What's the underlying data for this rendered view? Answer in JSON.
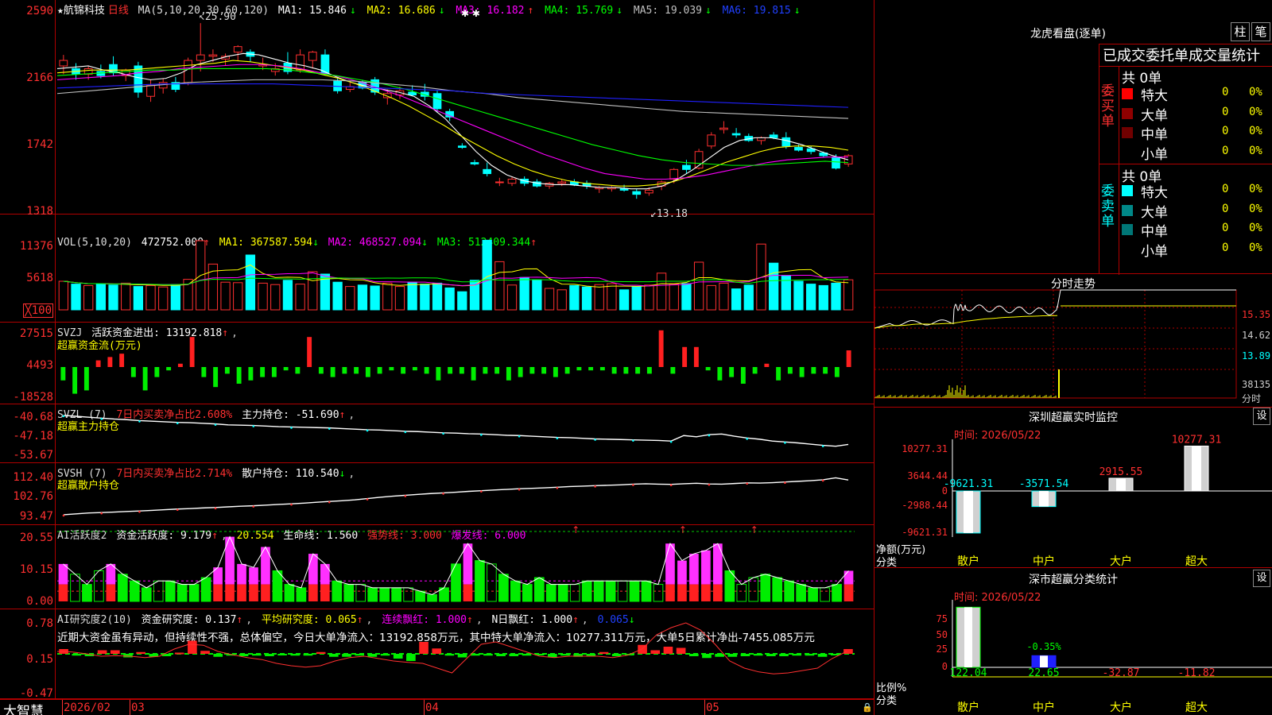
{
  "stock": {
    "name": "★航锦科技",
    "period": "日线"
  },
  "kline": {
    "params": "MA(5,10,20,30,60,120)",
    "ma": [
      {
        "label": "MA1: 15.846",
        "dir": "↓",
        "color": "#ffffff"
      },
      {
        "label": "MA2: 16.686",
        "dir": "↓",
        "color": "#ffff00"
      },
      {
        "label": "MA3: 16.182",
        "dir": "↑",
        "color": "#ff00ff"
      },
      {
        "label": "MA4: 15.769",
        "dir": "↓",
        "color": "#00ff00"
      },
      {
        "label": "MA5: 19.039",
        "dir": "↓",
        "color": "#c0c0c0"
      },
      {
        "label": "MA6: 19.815",
        "dir": "↓",
        "color": "#2020ff"
      }
    ],
    "high_label": "25.90",
    "low_label": "13.18",
    "y_ticks": [
      "2590",
      "2166",
      "1742",
      "1318"
    ],
    "y_range": [
      12.5,
      27.0
    ],
    "candles": [
      [
        22.8,
        23.6,
        22.2,
        23.2
      ],
      [
        22.6,
        23.0,
        21.8,
        22.2
      ],
      [
        22.2,
        22.8,
        21.8,
        22.6
      ],
      [
        22.4,
        22.9,
        21.9,
        22.1
      ],
      [
        22.9,
        23.5,
        22.1,
        22.3
      ],
      [
        22.1,
        22.6,
        21.7,
        22.5
      ],
      [
        22.8,
        23.1,
        20.5,
        20.9
      ],
      [
        20.6,
        21.8,
        20.2,
        21.4
      ],
      [
        21.2,
        21.9,
        20.8,
        21.6
      ],
      [
        21.6,
        22.0,
        20.9,
        21.1
      ],
      [
        21.6,
        23.4,
        21.4,
        23.2
      ],
      [
        23.2,
        25.9,
        22.4,
        23.6
      ],
      [
        23.5,
        24.0,
        23.1,
        23.6
      ],
      [
        23.3,
        23.7,
        22.8,
        23.5
      ],
      [
        23.8,
        24.3,
        23.2,
        24.2
      ],
      [
        23.8,
        24.0,
        23.1,
        23.5
      ],
      [
        22.8,
        23.4,
        22.5,
        22.9
      ],
      [
        22.4,
        23.0,
        22.1,
        22.6
      ],
      [
        23.0,
        23.8,
        22.2,
        22.4
      ],
      [
        22.5,
        24.0,
        22.3,
        23.6
      ],
      [
        23.2,
        23.9,
        22.6,
        23.8
      ],
      [
        23.6,
        24.0,
        22.1,
        22.2
      ],
      [
        21.7,
        21.9,
        20.8,
        21.0
      ],
      [
        21.1,
        21.6,
        20.9,
        21.3
      ],
      [
        21.6,
        21.8,
        21.1,
        21.2
      ],
      [
        21.8,
        22.0,
        20.7,
        20.9
      ],
      [
        20.5,
        21.1,
        20.0,
        20.8
      ],
      [
        20.7,
        21.3,
        20.4,
        21.0
      ],
      [
        20.9,
        21.4,
        20.6,
        20.7
      ],
      [
        20.9,
        21.5,
        20.3,
        20.6
      ],
      [
        20.8,
        21.0,
        19.4,
        19.7
      ],
      [
        19.5,
        19.7,
        18.8,
        19.1
      ],
      [
        17.0,
        17.2,
        16.8,
        16.9
      ],
      [
        15.8,
        16.0,
        15.6,
        15.7
      ],
      [
        15.3,
        15.8,
        14.8,
        15.0
      ],
      [
        14.4,
        14.7,
        14.1,
        14.4
      ],
      [
        14.3,
        14.8,
        14.1,
        14.6
      ],
      [
        14.6,
        14.8,
        14.1,
        14.3
      ],
      [
        14.4,
        14.6,
        14.0,
        14.1
      ],
      [
        14.1,
        14.4,
        13.9,
        14.3
      ],
      [
        14.3,
        14.6,
        14.1,
        14.4
      ],
      [
        14.4,
        14.6,
        14.1,
        14.2
      ],
      [
        14.3,
        14.5,
        13.9,
        14.1
      ],
      [
        13.9,
        14.1,
        13.6,
        14.0
      ],
      [
        13.9,
        14.1,
        13.7,
        14.0
      ],
      [
        13.9,
        14.2,
        13.7,
        13.8
      ],
      [
        13.7,
        13.9,
        13.18,
        13.5
      ],
      [
        13.6,
        14.0,
        13.4,
        13.8
      ],
      [
        14.1,
        14.5,
        13.8,
        14.4
      ],
      [
        14.6,
        15.4,
        14.3,
        15.3
      ],
      [
        15.6,
        16.0,
        15.0,
        15.3
      ],
      [
        15.4,
        16.8,
        15.3,
        16.6
      ],
      [
        17.0,
        18.0,
        16.8,
        17.8
      ],
      [
        18.2,
        18.8,
        17.9,
        18.3
      ],
      [
        17.9,
        18.3,
        17.6,
        17.8
      ],
      [
        17.7,
        17.9,
        17.3,
        17.4
      ],
      [
        17.4,
        17.7,
        17.1,
        17.6
      ],
      [
        17.8,
        18.0,
        17.5,
        17.6
      ],
      [
        17.6,
        18.0,
        16.8,
        17.0
      ],
      [
        16.9,
        17.1,
        16.6,
        16.7
      ],
      [
        16.8,
        17.0,
        16.4,
        16.6
      ],
      [
        16.5,
        16.6,
        16.2,
        16.3
      ],
      [
        16.2,
        16.4,
        15.3,
        15.4
      ],
      [
        15.7,
        16.4,
        15.5,
        16.3
      ]
    ],
    "ma_lines": [
      [
        22.6,
        22.7,
        22.8,
        22.5,
        22.3,
        22.0,
        21.8,
        21.9,
        22.3,
        22.9,
        23.2,
        23.5,
        23.7,
        23.6,
        23.3,
        23.0,
        22.8,
        22.5,
        22.0,
        21.6,
        21.3,
        21.1,
        20.9,
        20.6,
        19.9,
        19.0,
        17.8,
        16.6,
        15.6,
        14.9,
        14.5,
        14.3,
        14.2,
        14.2,
        14.1,
        14.0,
        14.0,
        13.9,
        13.9,
        14.1,
        14.6,
        15.3,
        16.1,
        16.9,
        17.4,
        17.6,
        17.6,
        17.4,
        17.1,
        16.7,
        16.3,
        16.0
      ],
      [
        22.3,
        22.4,
        22.5,
        22.5,
        22.5,
        22.6,
        22.7,
        22.8,
        22.9,
        23.0,
        23.2,
        23.1,
        22.9,
        22.7,
        22.5,
        22.2,
        21.9,
        21.5,
        21.0,
        20.5,
        19.9,
        19.2,
        18.5,
        17.7,
        17.0,
        16.3,
        15.7,
        15.2,
        14.8,
        14.5,
        14.3,
        14.2,
        14.1,
        14.1,
        14.2,
        14.4,
        14.8,
        15.3,
        15.8,
        16.2,
        16.6,
        16.9,
        17.0,
        17.0,
        16.9,
        16.7
      ],
      [
        21.8,
        21.9,
        22.0,
        22.1,
        22.3,
        22.4,
        22.6,
        22.7,
        22.8,
        22.9,
        22.9,
        22.8,
        22.6,
        22.3,
        22.0,
        21.6,
        21.1,
        20.6,
        20.0,
        19.4,
        18.8,
        18.2,
        17.6,
        17.0,
        16.4,
        15.9,
        15.4,
        15.0,
        14.8,
        14.6,
        14.6,
        14.7,
        14.9,
        15.2,
        15.5,
        15.8,
        16.0,
        16.1,
        16.2,
        16.2
      ],
      [
        22.1,
        22.2,
        22.3,
        22.4,
        22.5,
        22.5,
        22.6,
        22.6,
        22.6,
        22.6,
        22.5,
        22.3,
        22.1,
        21.8,
        21.5,
        21.1,
        20.6,
        20.1,
        19.6,
        19.1,
        18.6,
        18.1,
        17.6,
        17.1,
        16.7,
        16.3,
        16.0,
        15.8,
        15.7,
        15.6,
        15.6,
        15.7,
        15.8,
        15.9,
        15.8
      ],
      [
        20.8,
        21.0,
        21.2,
        21.4,
        21.6,
        21.7,
        21.8,
        21.8,
        21.8,
        21.7,
        21.5,
        21.3,
        21.0,
        20.8,
        20.5,
        20.3,
        20.1,
        19.9,
        19.7,
        19.5,
        19.4,
        19.3,
        19.2,
        19.1,
        19.0
      ],
      [
        21.2,
        21.3,
        21.4,
        21.5,
        21.5,
        21.5,
        21.5,
        21.4,
        21.3,
        21.2,
        21.1,
        21.0,
        20.8,
        20.7,
        20.6,
        20.5,
        20.4,
        20.3,
        20.2,
        20.1,
        20.0,
        19.9,
        19.8
      ]
    ]
  },
  "vol": {
    "params": "VOL(5,10,20)",
    "value": "472752.000",
    "dir": "↑",
    "ma1": "MA1: 367587.594",
    "ma1_dir": "↓",
    "ma2": "MA2: 468527.094",
    "ma2_dir": "↓",
    "ma3": "MA3: 512409.344",
    "ma3_dir": "↑",
    "y_ticks": [
      "11376",
      "5618",
      "╳100"
    ],
    "values": [
      6.0,
      5.4,
      5.1,
      5.5,
      5.2,
      5.6,
      4.9,
      5.1,
      4.8,
      5.3,
      6.4,
      14.5,
      9.6,
      5.8,
      5.7,
      11.5,
      5.6,
      5.3,
      6.2,
      5.4,
      8.0,
      7.5,
      5.8,
      4.9,
      5.2,
      5.0,
      5.6,
      4.9,
      5.8,
      5.4,
      5.6,
      4.6,
      3.8,
      6.2,
      14.6,
      10.1,
      5.2,
      6.8,
      6.3,
      4.5,
      4.2,
      5.1,
      4.8,
      5.3,
      5.5,
      4.2,
      4.9,
      5.2,
      7.7,
      5.4,
      5.5,
      10.0,
      5.1,
      5.6,
      4.4,
      5.2,
      13.8,
      9.8,
      7.2,
      6.0,
      5.4,
      5.1,
      5.6,
      6.3
    ]
  },
  "svzj": {
    "label": "SVZJ",
    "title": "活跃资金进出: 13192.818",
    "dir": "↑",
    "sub": "超赢资金流(万元)",
    "y_ticks": [
      "27515",
      "4493",
      "-18528"
    ],
    "values": [
      -4,
      -8,
      -7,
      2,
      3,
      4,
      -3,
      -7,
      -3,
      -1,
      1,
      9,
      -3,
      -6,
      -2,
      -5,
      -4,
      -3,
      -3,
      -1,
      -2,
      9,
      -2,
      -3,
      -2,
      -2,
      -3,
      -2,
      -1,
      -2,
      -1,
      -2,
      -4,
      -2,
      -2,
      -4,
      -2,
      -2,
      -4,
      -3,
      -2,
      -2,
      -3,
      -2,
      -1,
      -1,
      -1,
      -2,
      -2,
      -2,
      -2,
      11,
      -2,
      6,
      6,
      -1,
      -4,
      -3,
      -5,
      -2,
      1,
      -4,
      -2,
      -3,
      -2,
      -2,
      -3,
      5
    ]
  },
  "svzl": {
    "label": "SVZL (7)",
    "title_a": "7日内买卖净占比2.608%",
    "title_b": "主力持仓: -51.690",
    "dir": "↑",
    "sub": "超赢主力持仓",
    "y_ticks": [
      "-40.68",
      "-47.18",
      "-53.67"
    ],
    "values": [
      -42.2,
      -42.5,
      -42.8,
      -43.1,
      -43.4,
      -43.6,
      -43.9,
      -44.1,
      -44.3,
      -44.5,
      -44.6,
      -44.8,
      -45.0,
      -45.3,
      -45.4,
      -45.5,
      -45.7,
      -45.9,
      -46.0,
      -46.1,
      -46.2,
      -46.3,
      -46.5,
      -46.7,
      -46.9,
      -47.0,
      -47.2,
      -47.4,
      -47.5,
      -47.7,
      -47.9,
      -48.0,
      -48.2,
      -48.3,
      -48.5,
      -48.7,
      -48.8,
      -49.0,
      -49.2,
      -49.4,
      -49.5,
      -49.7,
      -49.9,
      -50.0,
      -50.1,
      -50.2,
      -50.3,
      -50.4,
      -50.6,
      -48.8,
      -49.2,
      -48.5,
      -48.3,
      -49.0,
      -49.6,
      -50.0,
      -50.6,
      -50.9,
      -51.2,
      -51.6,
      -52.0,
      -52.3,
      -51.7
    ]
  },
  "svsh": {
    "label": "SVSH (7)",
    "title_a": "7日内买卖净占比2.714%",
    "title_b": "散户持仓: 110.540",
    "dir": "↓",
    "sub": "超赢散户持仓",
    "y_ticks": [
      "112.40",
      "102.76",
      "93.47"
    ],
    "values": [
      94.6,
      95.0,
      95.4,
      95.6,
      95.8,
      96.1,
      96.3,
      96.6,
      96.9,
      97.2,
      97.4,
      97.7,
      97.9,
      98.2,
      98.5,
      98.7,
      99.0,
      99.3,
      99.6,
      99.9,
      100.3,
      100.7,
      101.0,
      101.4,
      102.0,
      102.6,
      103.1,
      103.5,
      103.9,
      104.3,
      104.6,
      104.9,
      105.3,
      105.6,
      105.9,
      106.2,
      106.5,
      106.7,
      106.9,
      107.2,
      107.5,
      107.7,
      107.9,
      108.1,
      108.3,
      108.6,
      108.8,
      108.6,
      108.5,
      108.8,
      109.0,
      108.7,
      108.6,
      108.9,
      109.2,
      109.1,
      109.3,
      109.6,
      109.9,
      110.2,
      110.6,
      111.5,
      110.5
    ]
  },
  "ai_active": {
    "label": "AI活跃度2",
    "t1": "资金活跃度: 9.179",
    "t1_dir": "↑",
    "t2": "20.554",
    "t3": "生命线: 1.560",
    "t4": "强势线: 3.000",
    "t5": "爆发线: 6.000",
    "y_ticks": [
      "20.55",
      "10.15",
      "0.00"
    ],
    "values": [
      11,
      8,
      5,
      9,
      11,
      8,
      6,
      4,
      6,
      6,
      5,
      5,
      7,
      10,
      19,
      11,
      10,
      16,
      9,
      5,
      4,
      14,
      11,
      6,
      5,
      5,
      4,
      4,
      4,
      4,
      3,
      2,
      4,
      11,
      17,
      12,
      11,
      8,
      6,
      5,
      7,
      5,
      5,
      5,
      6,
      6,
      6,
      6,
      6,
      6,
      5,
      17,
      12,
      14,
      15,
      17,
      9,
      5,
      7,
      8,
      7,
      6,
      5,
      4,
      4,
      5,
      9
    ],
    "pink": [
      1,
      0,
      0,
      0,
      1,
      0,
      0,
      0,
      0,
      0,
      0,
      0,
      0,
      1,
      1,
      1,
      1,
      1,
      0,
      0,
      0,
      1,
      1,
      0,
      0,
      0,
      0,
      0,
      0,
      0,
      0,
      0,
      0,
      0,
      1,
      0,
      0,
      0,
      0,
      0,
      0,
      0,
      0,
      0,
      0,
      0,
      0,
      0,
      0,
      0,
      0,
      1,
      1,
      1,
      1,
      1,
      0,
      0,
      0,
      0,
      0,
      0,
      0,
      0,
      0,
      0,
      1
    ],
    "arrows_at": [
      43,
      52,
      58
    ]
  },
  "ai_research": {
    "label": "AI研究度2(10)",
    "t1": "资金研究度: 0.137",
    "t1_dir": "↑",
    "t2": "平均研究度: 0.065",
    "t2_dir": "↑",
    "t3": "连续飘红: 1.000",
    "t3_dir": "↑",
    "t4": "N日飘红: 1.000",
    "t4_dir": "↑",
    "t5": "0.065",
    "t5_dir": "↓",
    "comment": "近期大资金虽有异动，但持续性不强，总体偏空，今日大单净流入：13192.858万元，其中特大单净流入：10277.311万元，大单5日累计净出-7455.085万元",
    "y_ticks": [
      "0.78",
      "0.15",
      "-0.47"
    ],
    "bars": [
      0.08,
      -0.03,
      -0.04,
      0.06,
      0.06,
      -0.06,
      0.03,
      -0.05,
      -0.04,
      0.02,
      0.22,
      0.05,
      -0.05,
      -0.03,
      -0.04,
      -0.03,
      -0.04,
      -0.02,
      -0.03,
      -0.03,
      0.03,
      -0.05,
      -0.05,
      -0.03,
      -0.05,
      -0.03,
      -0.08,
      -0.12,
      0.2,
      0.09,
      -0.03,
      -0.06,
      -0.03,
      -0.03,
      -0.04,
      -0.04,
      -0.03,
      -0.02,
      -0.06,
      -0.03,
      -0.05,
      -0.04,
      0.03,
      -0.04,
      -0.02,
      0.15,
      0.06,
      0.12,
      0.1,
      -0.04,
      -0.07,
      -0.05,
      -0.05,
      -0.04,
      -0.03,
      -0.04,
      -0.04,
      -0.03,
      -0.03,
      -0.05,
      -0.02,
      0.08
    ],
    "line": [
      0.05,
      0.04,
      0.0,
      -0.05,
      -0.04,
      -0.05,
      -0.08,
      -0.05,
      0.1,
      0.2,
      0.18,
      0.05,
      -0.02,
      -0.08,
      -0.12,
      -0.2,
      -0.25,
      -0.28,
      -0.25,
      -0.15,
      -0.08,
      -0.05,
      -0.1,
      -0.15,
      -0.18,
      -0.2,
      -0.3,
      -0.4,
      -0.1,
      0.2,
      0.25,
      0.15,
      0.05,
      -0.05,
      -0.08,
      -0.05,
      -0.05,
      -0.05,
      -0.08,
      -0.03,
      0.1,
      0.4,
      0.55,
      0.65,
      0.5,
      0.2,
      -0.15,
      -0.3,
      -0.38,
      -0.42,
      -0.4,
      -0.35,
      -0.3,
      -0.1,
      0.05
    ]
  },
  "x_axis": {
    "labels": [
      "2026/02",
      "03",
      "04",
      "05"
    ]
  },
  "brand": "大智慧",
  "dragon": {
    "title": "龙虎看盘(逐单)",
    "btn_zhu": "柱",
    "btn_bi": "笔",
    "stat_title": "已成交委托单成交量统计",
    "buy_side": "委买单",
    "sell_side": "委卖单",
    "buy_total": "共 0单",
    "sell_total": "共 0单",
    "buy_rows": [
      {
        "label": "特大",
        "n": "0",
        "p": "0%",
        "color": "#ff0000"
      },
      {
        "label": "大单",
        "n": "0",
        "p": "0%",
        "color": "#900000"
      },
      {
        "label": "中单",
        "n": "0",
        "p": "0%",
        "color": "#700000"
      },
      {
        "label": "小单",
        "n": "0",
        "p": "0%",
        "color": ""
      }
    ],
    "sell_rows": [
      {
        "label": "特大",
        "n": "0",
        "p": "0%",
        "color": "#00ffff"
      },
      {
        "label": "大单",
        "n": "0",
        "p": "0%",
        "color": "#008888"
      },
      {
        "label": "中单",
        "n": "0",
        "p": "0%",
        "color": "#007777"
      },
      {
        "label": "小单",
        "n": "0",
        "p": "0%",
        "color": ""
      }
    ]
  },
  "intraday": {
    "title": "分时走势",
    "right_ticks": [
      "15.35",
      "14.62",
      "13.89",
      "38135",
      "分时"
    ]
  },
  "monitor": {
    "title": "深圳超赢实时监控",
    "btn": "设",
    "time": "时间: 2026/05/22",
    "y_ticks": [
      "10277.31",
      "3644.44",
      "0",
      "-2988.44",
      "-9621.31"
    ],
    "y_label": "净额(万元)",
    "x_label": "分类",
    "bars": [
      {
        "cat": "散户",
        "value": -9621.31,
        "label": "-9621.31"
      },
      {
        "cat": "中户",
        "value": -3571.54,
        "label": "-3571.54"
      },
      {
        "cat": "大户",
        "value": 2915.55,
        "label": "2915.55"
      },
      {
        "cat": "超大",
        "value": 10277.31,
        "label": "10277.31"
      }
    ]
  },
  "classify": {
    "title": "深市超赢分类统计",
    "btn": "设",
    "time": "时间: 2026/05/22",
    "y_ticks": [
      "75",
      "50",
      "25",
      "0"
    ],
    "y_label": "比例%",
    "x_label": "分类",
    "bars": [
      {
        "cat": "散户",
        "value": 122.04,
        "label": "122.04"
      },
      {
        "cat": "中户",
        "value": 22.65,
        "label": "22.65",
        "pct": "-0.35%"
      },
      {
        "cat": "大户",
        "value": -32.87,
        "label": "-32.87"
      },
      {
        "cat": "超大",
        "value": -11.82,
        "label": "-11.82"
      }
    ]
  }
}
